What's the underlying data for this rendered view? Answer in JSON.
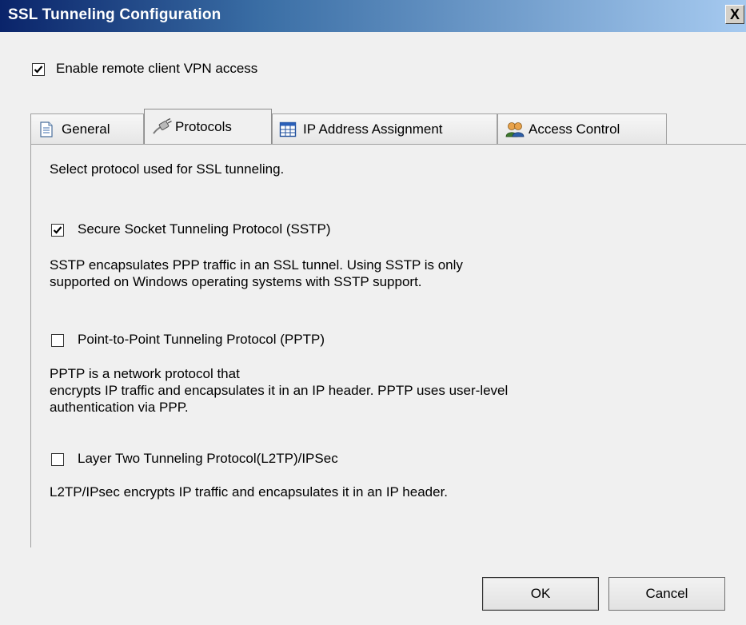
{
  "window": {
    "title": "SSL Tunneling Configuration",
    "close_label": "X"
  },
  "enable_vpn": {
    "label": "Enable remote client VPN access",
    "checked": true
  },
  "tabs": [
    {
      "label": "General",
      "icon": "document-icon",
      "active": false
    },
    {
      "label": "Protocols",
      "icon": "protocol-plug-icon",
      "active": true
    },
    {
      "label": "IP Address Assignment",
      "icon": "ip-table-icon",
      "active": false
    },
    {
      "label": "Access Control",
      "icon": "users-icon",
      "active": false
    }
  ],
  "protocols_panel": {
    "intro": "Select protocol used for SSL tunneling.",
    "sstp": {
      "label": "Secure Socket Tunneling Protocol (SSTP)",
      "checked": true,
      "description": [
        "SSTP encapsulates PPP traffic in an SSL tunnel. Using SSTP is only",
        "supported on Windows operating systems with SSTP support."
      ]
    },
    "pptp": {
      "label": "Point-to-Point Tunneling Protocol (PPTP)",
      "checked": false,
      "description": [
        "PPTP is a network protocol that",
        "encrypts IP traffic and encapsulates it in an IP header. PPTP uses user-level",
        "authentication via PPP."
      ]
    },
    "l2tp": {
      "label": "Layer Two Tunneling Protocol(L2TP)/IPSec",
      "checked": false,
      "description": [
        "L2TP/IPsec encrypts IP traffic and encapsulates it in an IP header."
      ]
    }
  },
  "buttons": {
    "ok": "OK",
    "cancel": "Cancel"
  }
}
